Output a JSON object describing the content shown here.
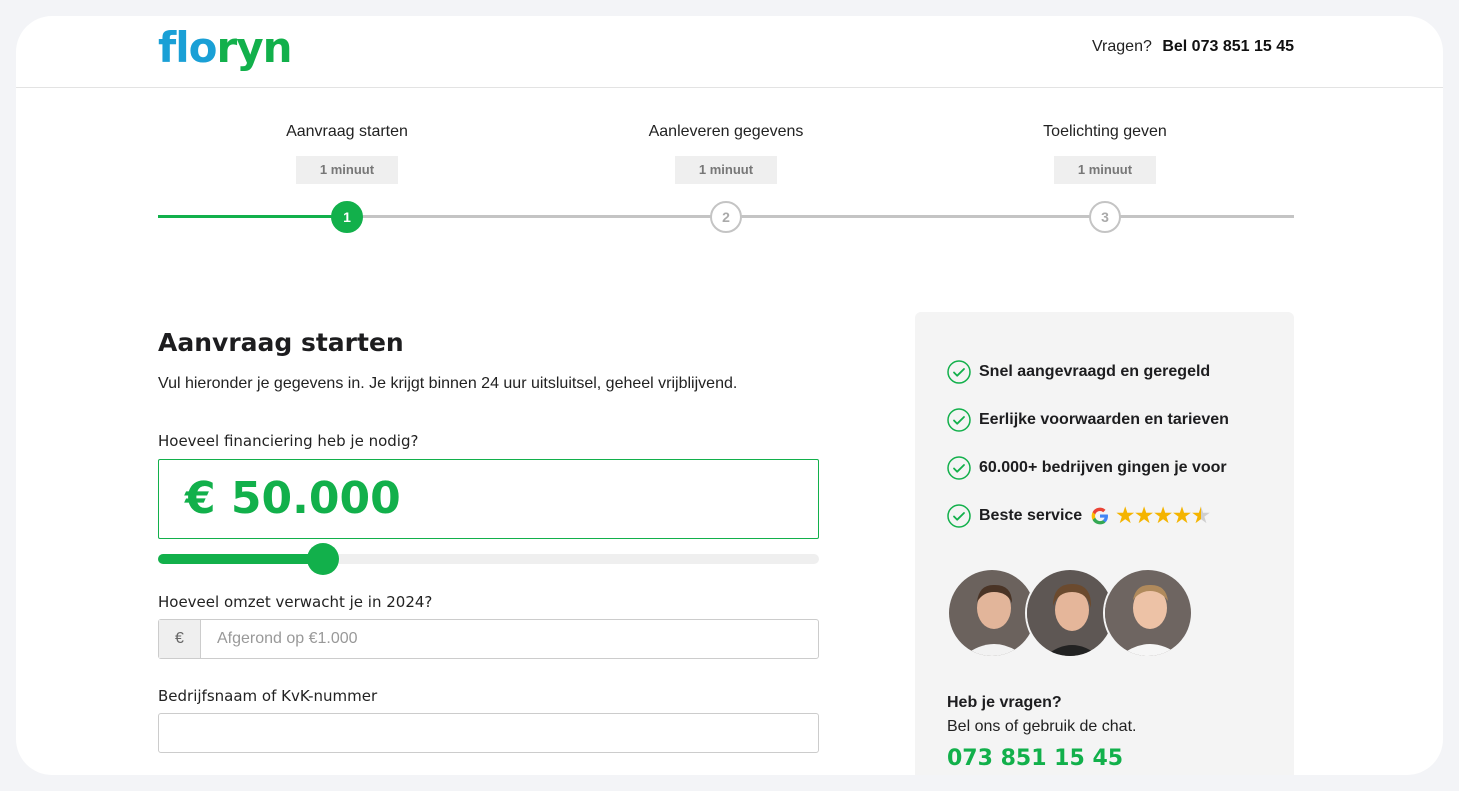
{
  "brand": {
    "logo_part1": "flo",
    "logo_part2": "ryn"
  },
  "header": {
    "question": "Vragen?",
    "phone": "Bel 073 851 15 45"
  },
  "steps": [
    {
      "title": "Aanvraag starten",
      "duration": "1 minuut",
      "number": "1",
      "state": "active"
    },
    {
      "title": "Aanleveren gegevens",
      "duration": "1 minuut",
      "number": "2",
      "state": "idle"
    },
    {
      "title": "Toelichting geven",
      "duration": "1 minuut",
      "number": "3",
      "state": "idle"
    }
  ],
  "form": {
    "title": "Aanvraag starten",
    "intro": "Vul hieronder je gegevens in. Je krijgt binnen 24 uur uitsluitsel, geheel vrijblijvend.",
    "financing_label": "Hoeveel financiering heb je nodig?",
    "financing_value": "€ 50.000",
    "slider_fraction": 0.25,
    "revenue_label": "Hoeveel omzet verwacht je in 2024?",
    "revenue_prefix": "€",
    "revenue_placeholder": "Afgerond op €1.000",
    "company_label": "Bedrijfsnaam of KvK-nummer",
    "company_value": ""
  },
  "sidebar": {
    "usps": [
      "Snel aangevraagd en geregeld",
      "Eerlijke voorwaarden en tarieven",
      "60.000+ bedrijven gingen je voor",
      "Beste service"
    ],
    "rating_stars": 4.5,
    "help_title": "Heb je vragen?",
    "help_text": "Bel ons of gebruik de chat.",
    "help_phone": "073 851 15 45"
  },
  "colors": {
    "green": "#12b04b",
    "blue": "#1aa0d6",
    "panel": "#f4f4f4"
  }
}
